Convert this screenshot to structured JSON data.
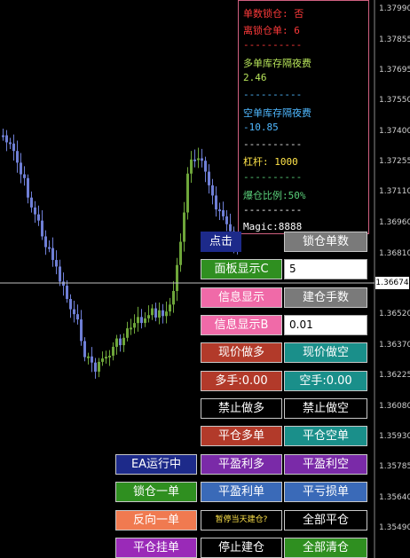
{
  "axis": {
    "prices": [
      "1.37990",
      "1.37855",
      "1.37695",
      "1.37550",
      "1.37400",
      "1.37255",
      "1.37110",
      "1.36960",
      "1.36810",
      "1.36674",
      "1.36520",
      "1.36370",
      "1.36225",
      "1.36080",
      "1.35930",
      "1.35785",
      "1.35640",
      "1.35490"
    ],
    "current_price": "1.36674"
  },
  "info_panel": {
    "lines": [
      {
        "text": "单数锁仓: 否",
        "color": "#ff3a3a"
      },
      {
        "text": "离锁仓单: 6",
        "color": "#ff3a3a"
      },
      {
        "text": "----------",
        "color": "#ff3a3a"
      },
      {
        "text": "多单库存隔夜费",
        "color": "#b7e45a"
      },
      {
        "text": "2.46",
        "color": "#b7e45a"
      },
      {
        "text": "----------",
        "color": "#4fb8ff"
      },
      {
        "text": "空单库存隔夜费",
        "color": "#4fb8ff"
      },
      {
        "text": "-10.85",
        "color": "#4fb8ff"
      },
      {
        "text": "----------",
        "color": "#e8e8e8"
      },
      {
        "text": "杠杆: 1000",
        "color": "#ffe44a"
      },
      {
        "text": "----------",
        "color": "#5ad07a"
      },
      {
        "text": "爆仓比例:50%",
        "color": "#5ad07a"
      },
      {
        "text": "----------",
        "color": "#ffffff"
      },
      {
        "text": "Magic:8888",
        "color": "#ffffff"
      }
    ]
  },
  "panel": {
    "click_label": "点击",
    "lock_count": "锁仓单数",
    "panel_show_c": "面板显示C",
    "input_c": "5",
    "info_show": "信息显示",
    "build_lots": "建仓手数",
    "info_show_b": "信息显示B",
    "input_lots": "0.01",
    "market_buy": "现价做多",
    "market_sell": "现价做空",
    "long_lots": "多手:0.00",
    "short_lots": "空手:0.00",
    "no_long": "禁止做多",
    "no_short": "禁止做空",
    "close_long": "平仓多单",
    "close_short": "平仓空单",
    "ea_running": "EA运行中",
    "close_profit_long": "平盈利多",
    "close_profit_short": "平盈利空",
    "lock_one": "锁仓一单",
    "close_profit": "平盈利单",
    "close_loss": "平亏损单",
    "reverse_one": "反向一单",
    "pause_today": "暂停当天建仓?",
    "close_all": "全部平仓",
    "close_pending": "平仓挂单",
    "stop_build": "停止建仓",
    "clear_all": "全部清仓"
  },
  "colors": {
    "bull": "#6ea63a",
    "bear": "#6f7fd6",
    "price_line": "#c0c0c0"
  }
}
